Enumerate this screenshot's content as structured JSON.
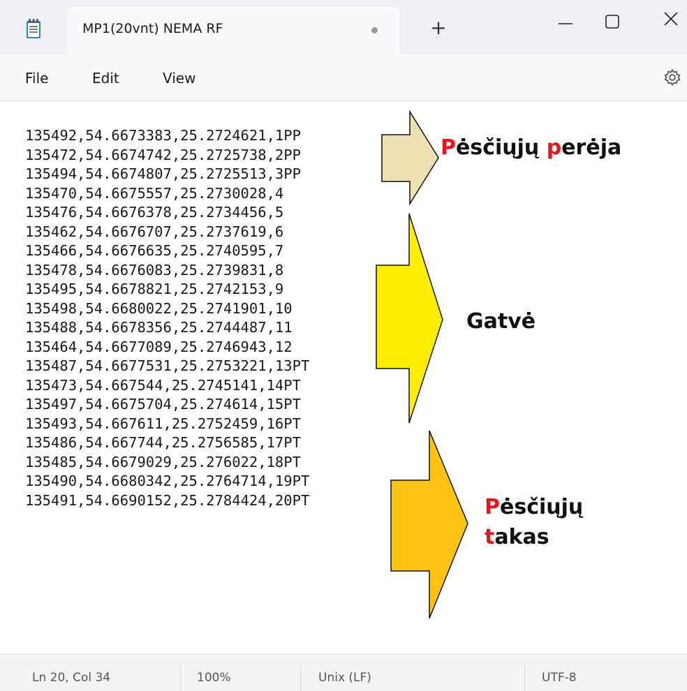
{
  "window": {
    "tab_title": "MP1(20vnt) NEMA RF",
    "new_tab_glyph": "+",
    "icons": [
      "notepad-icon",
      "unsaved-dot-icon",
      "plus-icon",
      "minimize-icon",
      "maximize-icon",
      "close-icon"
    ]
  },
  "menu": {
    "file": "File",
    "edit": "Edit",
    "view": "View",
    "settings_icon": "gear-icon"
  },
  "editor": {
    "lines": [
      "135492,54.6673383,25.2724621,1PP",
      "135472,54.6674742,25.2725738,2PP",
      "135494,54.6674807,25.2725513,3PP",
      "135470,54.6675557,25.2730028,4",
      "135476,54.6676378,25.2734456,5",
      "135462,54.6676707,25.2737619,6",
      "135466,54.6676635,25.2740595,7",
      "135478,54.6676083,25.2739831,8",
      "135495,54.6678821,25.2742153,9",
      "135498,54.6680022,25.2741901,10",
      "135488,54.6678356,25.2744487,11",
      "135464,54.6677089,25.2746943,12",
      "135487,54.6677531,25.2753221,13PT",
      "135473,54.667544,25.2745141,14PT",
      "135497,54.6675704,25.274614,15PT",
      "135493,54.667611,25.2752459,16PT",
      "135486,54.667744,25.2756585,17PT",
      "135485,54.6679029,25.276022,18PT",
      "135490,54.6680342,25.2764714,19PT",
      "135491,54.6690152,25.2784424,20PT"
    ]
  },
  "annotations": {
    "crossing": {
      "first": "P",
      "mid": "ėsčiųjų ",
      "second": "p",
      "rest": "erėja",
      "arrow_color": "#efe0b4"
    },
    "street": {
      "text": "Gatvė",
      "arrow_color": "#ffee00"
    },
    "path": {
      "line1_first": "P",
      "line1_rest": "ėsčiųjų",
      "line2_first": "t",
      "line2_rest": "akas",
      "arrow_color": "#ffc413"
    },
    "highlight_color": "#e8141c"
  },
  "status": {
    "position": "Ln 20, Col 34",
    "zoom": "100%",
    "line_ending": "Unix (LF)",
    "encoding": "UTF-8"
  }
}
